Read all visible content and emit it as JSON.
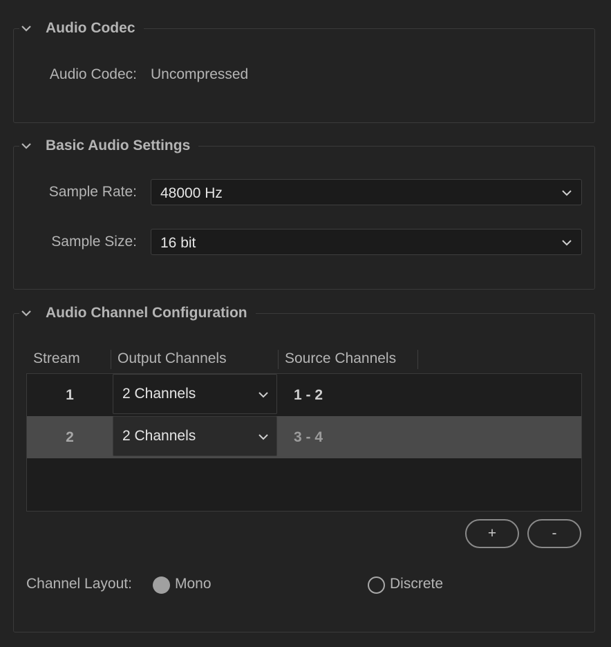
{
  "audio_codec": {
    "title": "Audio Codec",
    "label": "Audio Codec:",
    "value": "Uncompressed"
  },
  "basic_audio": {
    "title": "Basic Audio Settings",
    "sample_rate": {
      "label": "Sample Rate:",
      "value": "48000 Hz"
    },
    "sample_size": {
      "label": "Sample Size:",
      "value": "16 bit"
    }
  },
  "channel_config": {
    "title": "Audio Channel Configuration",
    "columns": [
      "Stream",
      "Output Channels",
      "Source Channels"
    ],
    "rows": [
      {
        "stream": "1",
        "output": "2 Channels",
        "source": "1 - 2",
        "selected": false
      },
      {
        "stream": "2",
        "output": "2 Channels",
        "source": "3 - 4",
        "selected": true
      }
    ],
    "add_label": "+",
    "remove_label": "-",
    "layout_label": "Channel Layout:",
    "layout_options": [
      {
        "label": "Mono",
        "selected": true
      },
      {
        "label": "Discrete",
        "selected": false
      }
    ]
  },
  "colors": {
    "background": "#232323",
    "selected_row": "#4a4a4a",
    "text": "#b5b5b5"
  }
}
